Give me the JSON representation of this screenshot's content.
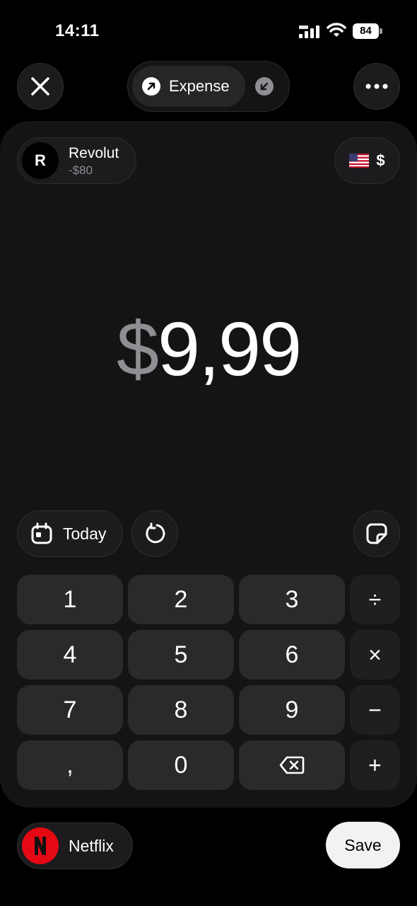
{
  "status_bar": {
    "time": "14:11",
    "battery": "84"
  },
  "transaction_type": {
    "expense_label": "Expense"
  },
  "account": {
    "avatar_letter": "R",
    "name": "Revolut",
    "balance": "-$80"
  },
  "currency": {
    "symbol": "$",
    "flag": "us-flag-icon"
  },
  "amount": {
    "symbol": "$",
    "value": "9,99"
  },
  "date": {
    "label": "Today"
  },
  "keypad": {
    "rows": [
      [
        "1",
        "2",
        "3",
        "÷"
      ],
      [
        "4",
        "5",
        "6",
        "×"
      ],
      [
        "7",
        "8",
        "9",
        "−"
      ],
      [
        ",",
        "0",
        "⌫",
        "+"
      ]
    ]
  },
  "category": {
    "name": "Netflix",
    "logo_letter": "N"
  },
  "actions": {
    "save_label": "Save"
  },
  "colors": {
    "background": "#000000",
    "card": "#141414",
    "key": "#2a2a2c",
    "netflix_red": "#e50914",
    "muted": "#8e8e93"
  }
}
